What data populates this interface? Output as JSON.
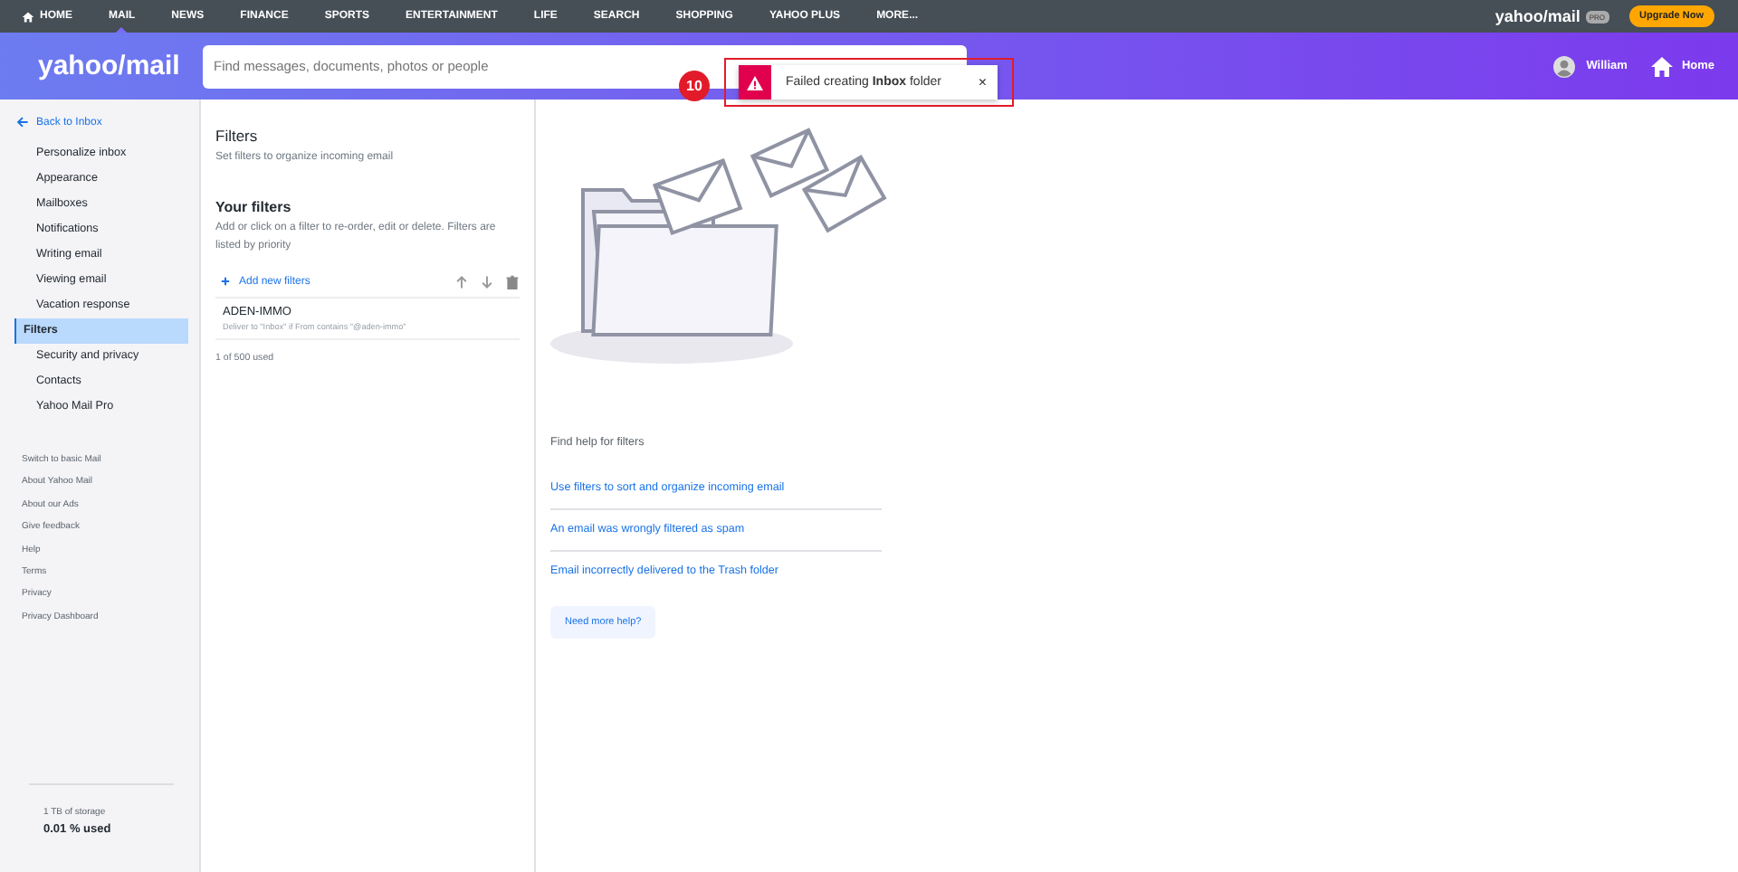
{
  "top_nav": {
    "items": [
      {
        "label": "HOME",
        "kind": "home",
        "selected": false
      },
      {
        "label": "MAIL",
        "kind": "text",
        "selected": true
      },
      {
        "label": "NEWS",
        "kind": "text",
        "selected": false
      },
      {
        "label": "FINANCE",
        "kind": "text",
        "selected": false
      },
      {
        "label": "SPORTS",
        "kind": "text",
        "selected": false
      },
      {
        "label": "ENTERTAINMENT",
        "kind": "text",
        "selected": false
      },
      {
        "label": "LIFE",
        "kind": "text",
        "selected": false
      },
      {
        "label": "SEARCH",
        "kind": "text",
        "selected": false
      },
      {
        "label": "SHOPPING",
        "kind": "text",
        "selected": false
      },
      {
        "label": "YAHOO PLUS",
        "kind": "text",
        "selected": false
      },
      {
        "label": "MORE...",
        "kind": "text",
        "selected": false
      }
    ],
    "brand": "yahoo/mail",
    "brand_badge": "PRO",
    "upgrade": "Upgrade Now"
  },
  "header": {
    "logo": "yahoo/mail",
    "search": {
      "placeholder": "Find messages, documents, photos or people"
    },
    "user": "William",
    "home": "Home"
  },
  "toast": {
    "callout": "10",
    "message": "Failed creating **Inbox** folder",
    "close": "×"
  },
  "sidebar": {
    "back": "Back to Inbox",
    "items": [
      {
        "label": "Personalize inbox",
        "selected": false
      },
      {
        "label": "Appearance",
        "selected": false
      },
      {
        "label": "Mailboxes",
        "selected": false
      },
      {
        "label": "Notifications",
        "selected": false
      },
      {
        "label": "Writing email",
        "selected": false
      },
      {
        "label": "Viewing email",
        "selected": false
      },
      {
        "label": "Vacation response",
        "selected": false
      },
      {
        "label": "Filters",
        "selected": true
      },
      {
        "label": "Security and privacy",
        "selected": false
      },
      {
        "label": "Contacts",
        "selected": false
      },
      {
        "label": "Yahoo Mail Pro",
        "selected": false
      }
    ],
    "links": [
      "Switch to basic Mail",
      "About Yahoo Mail",
      "About our Ads",
      "Give feedback",
      "Help",
      "Terms",
      "Privacy",
      "Privacy Dashboard"
    ],
    "storage": "1 TB of storage",
    "used": "0.01 % used"
  },
  "filters": {
    "title": "Filters",
    "subtitle": "Set filters to organize incoming email",
    "your_filters": "Your filters",
    "description": "Add or click on a filter to re-order, edit or delete. Filters are listed by priority",
    "add": "Add new filters",
    "rows": [
      {
        "name": "ADEN-IMMO",
        "rule": "Deliver to \"Inbox\" if From contains \"@aden-immo\""
      }
    ],
    "count": "1 of 500 used"
  },
  "help": {
    "title": "Find help for filters",
    "links": [
      "Use filters to sort and organize incoming email",
      "An email was wrongly filtered as spam",
      "Email incorrectly delivered to the Trash folder"
    ],
    "button": "Need more help?"
  }
}
